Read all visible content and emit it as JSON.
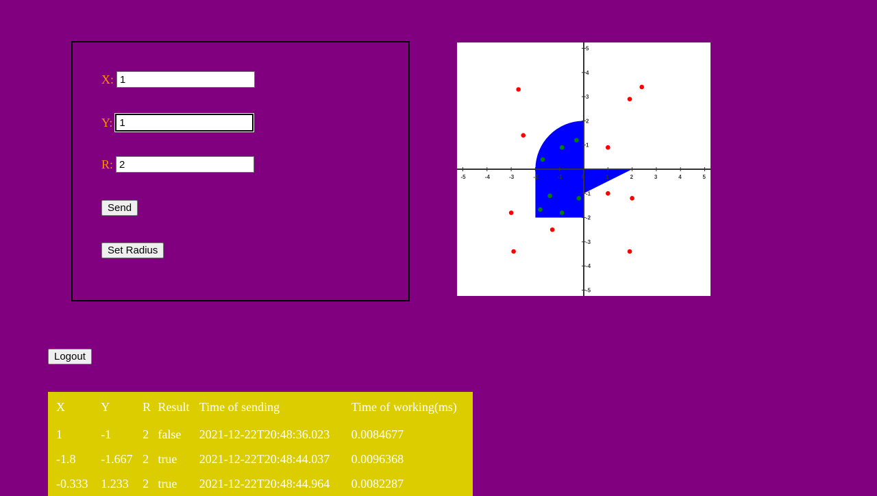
{
  "form": {
    "x": {
      "label": "X:",
      "value": "1"
    },
    "y": {
      "label": "Y:",
      "value": "1"
    },
    "r": {
      "label": "R:",
      "value": "2"
    },
    "send_label": "Send",
    "set_radius_label": "Set Radius"
  },
  "logout_label": "Logout",
  "plot": {
    "x_ticks": [
      "-5",
      "-4",
      "-3",
      "-2",
      "-1",
      "0",
      "1",
      "2",
      "3",
      "4",
      "5"
    ],
    "y_ticks": [
      "-5",
      "-4",
      "-3",
      "-2",
      "-1",
      "1",
      "2",
      "3",
      "4",
      "5"
    ],
    "xlim": [
      -5,
      5
    ],
    "ylim": [
      -5,
      5
    ],
    "area_color": "#0000ff",
    "hit_color": "#008000",
    "miss_color": "#ff0000",
    "radius": 2,
    "points": [
      {
        "x": -2.7,
        "y": 3.3,
        "hit": false
      },
      {
        "x": 1.9,
        "y": 2.9,
        "hit": false
      },
      {
        "x": 2.4,
        "y": 3.4,
        "hit": false
      },
      {
        "x": -2.5,
        "y": 1.4,
        "hit": false
      },
      {
        "x": 1.0,
        "y": 0.9,
        "hit": false
      },
      {
        "x": -0.3,
        "y": 1.2,
        "hit": true
      },
      {
        "x": -0.9,
        "y": 0.9,
        "hit": true
      },
      {
        "x": -1.7,
        "y": 0.4,
        "hit": true
      },
      {
        "x": 1.0,
        "y": -1.0,
        "hit": false
      },
      {
        "x": 2.0,
        "y": -1.2,
        "hit": false
      },
      {
        "x": -1.4,
        "y": -1.1,
        "hit": true
      },
      {
        "x": -0.2,
        "y": -1.2,
        "hit": true
      },
      {
        "x": -1.8,
        "y": -1.667,
        "hit": true
      },
      {
        "x": -0.9,
        "y": -1.8,
        "hit": true
      },
      {
        "x": -3.0,
        "y": -1.8,
        "hit": false
      },
      {
        "x": -1.3,
        "y": -2.5,
        "hit": false
      },
      {
        "x": -2.9,
        "y": -3.4,
        "hit": false
      },
      {
        "x": 1.9,
        "y": -3.4,
        "hit": false
      }
    ]
  },
  "table": {
    "headers": [
      "X",
      "Y",
      "R",
      "Result",
      "Time of sending",
      "Time of working(ms)"
    ],
    "rows": [
      [
        "1",
        "-1",
        "2",
        "false",
        "2021-12-22T20:48:36.023",
        "0.0084677"
      ],
      [
        "-1.8",
        "-1.667",
        "2",
        "true",
        "2021-12-22T20:48:44.037",
        "0.0096368"
      ],
      [
        "-0.333",
        "1.233",
        "2",
        "true",
        "2021-12-22T20:48:44.964",
        "0.0082287"
      ]
    ]
  },
  "colors": {
    "background": "#800080",
    "label": "#ff8c00",
    "table_bg": "#dccd00"
  }
}
